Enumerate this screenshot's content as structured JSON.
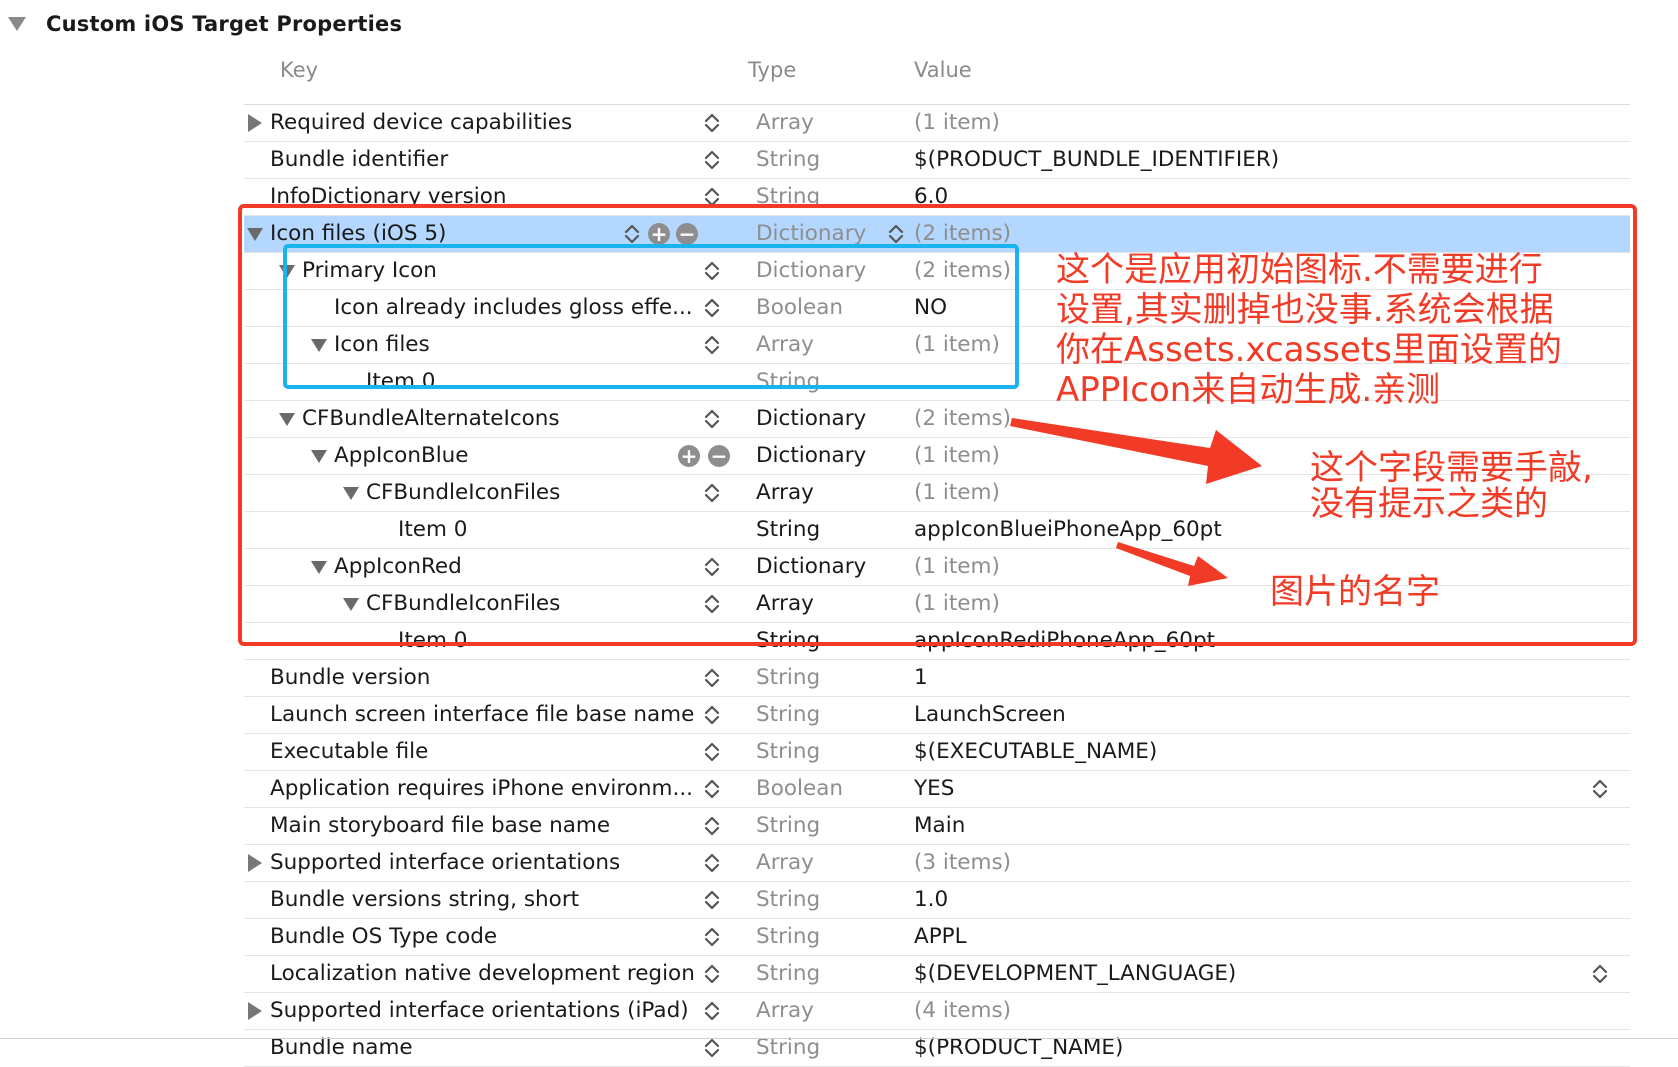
{
  "section": {
    "title": "Custom iOS Target Properties"
  },
  "columns": {
    "key": "Key",
    "type": "Type",
    "value": "Value"
  },
  "rows": [
    {
      "key": "Required device capabilities",
      "type": "Array",
      "value": "(1 item)",
      "disclosure": "collapsed",
      "indent": 0,
      "dim_type": true,
      "dim_value": true
    },
    {
      "key": "Bundle identifier",
      "type": "String",
      "value": "$(PRODUCT_BUNDLE_IDENTIFIER)",
      "indent": 0,
      "dim_type": true
    },
    {
      "key": "InfoDictionary version",
      "type": "String",
      "value": "6.0",
      "indent": 0,
      "dim_type": true
    },
    {
      "key": "Icon files (iOS 5)",
      "type": "Dictionary",
      "value": "(2 items)",
      "disclosure": "expanded",
      "indent": 0,
      "selected": true,
      "dim_type": true,
      "dim_value": true
    },
    {
      "key": "Primary Icon",
      "type": "Dictionary",
      "value": "(2 items)",
      "disclosure": "expanded",
      "indent": 1,
      "dim_type": true,
      "dim_value": true
    },
    {
      "key": "Icon already includes gloss effe...",
      "type": "Boolean",
      "value": "NO",
      "indent": 2,
      "dim_type": true
    },
    {
      "key": "Icon files",
      "type": "Array",
      "value": "(1 item)",
      "disclosure": "expanded",
      "indent": 2,
      "dim_type": true,
      "dim_value": true
    },
    {
      "key": "Item 0",
      "type": "String",
      "value": "",
      "indent": 3,
      "dim_type": true,
      "no_stepper": true
    },
    {
      "key": "CFBundleAlternateIcons",
      "type": "Dictionary",
      "value": "(2 items)",
      "disclosure": "expanded",
      "indent": 1,
      "dim_value": true
    },
    {
      "key": "AppIconBlue",
      "type": "Dictionary",
      "value": "(1 item)",
      "disclosure": "expanded",
      "indent": 2,
      "dim_value": true,
      "plus_minus": true,
      "no_stepper": true
    },
    {
      "key": "CFBundleIconFiles",
      "type": "Array",
      "value": "(1 item)",
      "disclosure": "expanded",
      "indent": 3,
      "dim_value": true,
      "no_stepper": true
    },
    {
      "key": "Item 0",
      "type": "String",
      "value": "appIconBlueiPhoneApp_60pt",
      "indent": 4,
      "no_stepper": true
    },
    {
      "key": "AppIconRed",
      "type": "Dictionary",
      "value": "(1 item)",
      "disclosure": "expanded",
      "indent": 2,
      "dim_value": true,
      "no_stepper": true
    },
    {
      "key": "CFBundleIconFiles",
      "type": "Array",
      "value": "(1 item)",
      "disclosure": "expanded",
      "indent": 3,
      "dim_value": true,
      "no_stepper": true
    },
    {
      "key": "Item 0",
      "type": "String",
      "value": "appIconRediPhoneApp_60pt",
      "indent": 4,
      "no_stepper": true
    },
    {
      "key": "Bundle version",
      "type": "String",
      "value": "1",
      "indent": 0,
      "dim_type": true
    },
    {
      "key": "Launch screen interface file base name",
      "type": "String",
      "value": "LaunchScreen",
      "indent": 0,
      "dim_type": true
    },
    {
      "key": "Executable file",
      "type": "String",
      "value": "$(EXECUTABLE_NAME)",
      "indent": 0,
      "dim_type": true
    },
    {
      "key": "Application requires iPhone environm...",
      "type": "Boolean",
      "value": "YES",
      "indent": 0,
      "dim_type": true,
      "value_stepper": true
    },
    {
      "key": "Main storyboard file base name",
      "type": "String",
      "value": "Main",
      "indent": 0,
      "dim_type": true
    },
    {
      "key": "Supported interface orientations",
      "type": "Array",
      "value": "(3 items)",
      "disclosure": "collapsed",
      "indent": 0,
      "dim_type": true,
      "dim_value": true
    },
    {
      "key": "Bundle versions string, short",
      "type": "String",
      "value": "1.0",
      "indent": 0,
      "dim_type": true
    },
    {
      "key": "Bundle OS Type code",
      "type": "String",
      "value": "APPL",
      "indent": 0,
      "dim_type": true
    },
    {
      "key": "Localization native development region",
      "type": "String",
      "value": "$(DEVELOPMENT_LANGUAGE)",
      "indent": 0,
      "dim_type": true,
      "value_stepper": true
    },
    {
      "key": "Supported interface orientations (iPad)",
      "type": "Array",
      "value": "(4 items)",
      "disclosure": "collapsed",
      "indent": 0,
      "dim_type": true,
      "dim_value": true
    },
    {
      "key": "Bundle name",
      "type": "String",
      "value": "$(PRODUCT_NAME)",
      "indent": 0,
      "dim_type": true
    }
  ],
  "annotations": {
    "note1": [
      "这个是应用初始图标.不需要进行",
      "设置,其实删掉也没事.系统会根据",
      "你在Assets.xcassets里面设置的",
      "APPIcon来自动生成.亲测"
    ],
    "note2": [
      "这个字段需要手敲,",
      "没有提示之类的"
    ],
    "note3": "图片的名字",
    "colors": {
      "red": "#f13b26",
      "blue": "#19b3f0",
      "selection": "#b3d7ff"
    }
  }
}
